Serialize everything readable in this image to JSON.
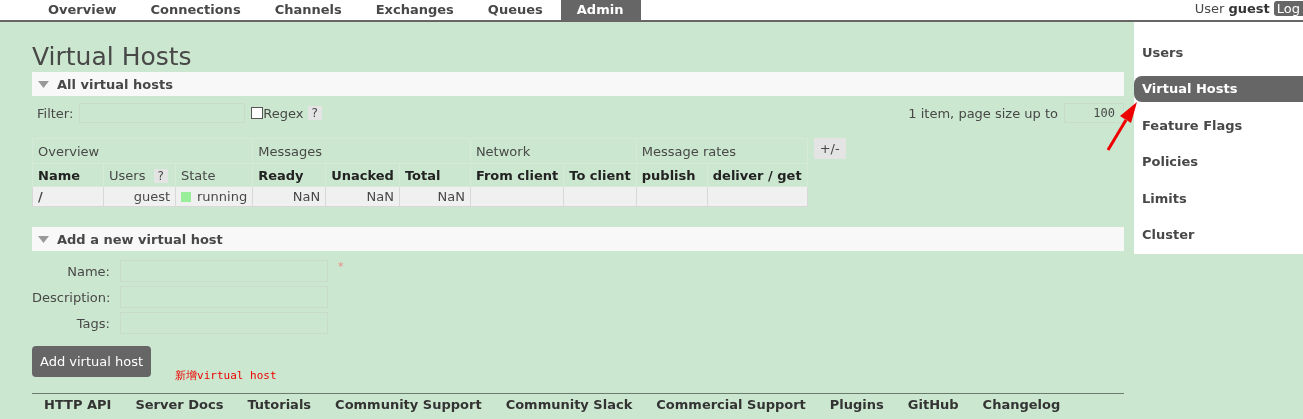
{
  "nav": {
    "tabs": [
      {
        "label": "Overview",
        "selected": false
      },
      {
        "label": "Connections",
        "selected": false
      },
      {
        "label": "Channels",
        "selected": false
      },
      {
        "label": "Exchanges",
        "selected": false
      },
      {
        "label": "Queues",
        "selected": false
      },
      {
        "label": "Admin",
        "selected": true
      }
    ],
    "user_label": "User",
    "user_name": "guest",
    "logout": "Log"
  },
  "title": "Virtual Hosts",
  "all_section": {
    "heading": "All virtual hosts",
    "expanded": true,
    "filter_label": "Filter:",
    "regex_label": "Regex",
    "regex_checked": false,
    "help": "?",
    "paging_text": "1 item, page size up to",
    "page_size": "100",
    "table": {
      "groups": [
        {
          "label": "Overview"
        },
        {
          "label": "Messages"
        },
        {
          "label": "Network"
        },
        {
          "label": "Message rates"
        }
      ],
      "columns": [
        {
          "label": "Name",
          "bold": true
        },
        {
          "label": "Users",
          "bold": false,
          "help": "?"
        },
        {
          "label": "State",
          "bold": false
        },
        {
          "label": "Ready",
          "bold": true
        },
        {
          "label": "Unacked",
          "bold": true
        },
        {
          "label": "Total",
          "bold": true
        },
        {
          "label": "From client",
          "bold": true
        },
        {
          "label": "To client",
          "bold": true
        },
        {
          "label": "publish",
          "bold": true
        },
        {
          "label": "deliver / get",
          "bold": true
        }
      ],
      "rows": [
        {
          "name": "/",
          "users": "guest",
          "state": "running",
          "color": "#99ee99",
          "ready": "NaN",
          "unacked": "NaN",
          "total": "NaN"
        }
      ],
      "toggle": "+/-"
    }
  },
  "add_section": {
    "heading": "Add a new virtual host",
    "expanded": true,
    "fields": [
      {
        "label": "Name:",
        "required_mark": "*"
      },
      {
        "label": "Description:"
      },
      {
        "label": "Tags:"
      }
    ],
    "button": "Add virtual host",
    "annotation": "新增virtual host"
  },
  "sidebar": {
    "items": [
      {
        "label": "Users",
        "selected": false
      },
      {
        "label": "Virtual Hosts",
        "selected": true
      },
      {
        "label": "Feature Flags",
        "selected": false
      },
      {
        "label": "Policies",
        "selected": false
      },
      {
        "label": "Limits",
        "selected": false
      },
      {
        "label": "Cluster",
        "selected": false
      }
    ]
  },
  "footer": {
    "links": [
      "HTTP API",
      "Server Docs",
      "Tutorials",
      "Community Support",
      "Community Slack",
      "Commercial Support",
      "Plugins",
      "GitHub",
      "Changelog"
    ]
  }
}
